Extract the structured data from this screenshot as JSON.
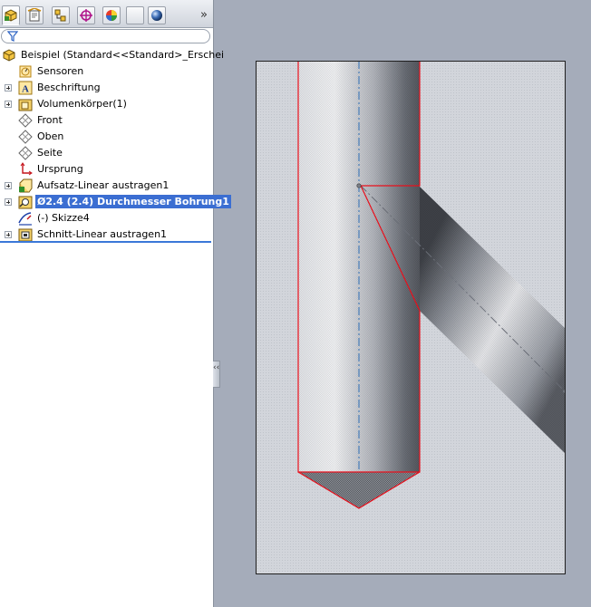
{
  "tabs": [
    {
      "name": "featuremanager-tab",
      "icon": "featuremanager-icon"
    },
    {
      "name": "propertymanager-tab",
      "icon": "propertymanager-icon"
    },
    {
      "name": "configurationmanager-tab",
      "icon": "configurationmanager-icon"
    },
    {
      "name": "dimxpert-tab",
      "icon": "dimxpert-icon"
    },
    {
      "name": "display-manager-tab",
      "icon": "display-manager-icon"
    },
    {
      "name": "empty-tab",
      "icon": ""
    },
    {
      "name": "appearance-tab",
      "icon": "sphere-icon"
    }
  ],
  "tabs_more": "»",
  "filter": {
    "icon": "filter-icon",
    "value": ""
  },
  "tree": {
    "root": {
      "label": "Beispiel  (Standard<<Standard>_Erschei",
      "icon": "part-icon"
    },
    "items": [
      {
        "label": "Sensoren",
        "icon": "sensor-icon",
        "expandable": false
      },
      {
        "label": "Beschriftung",
        "icon": "annotation-icon",
        "expandable": true
      },
      {
        "label": "Volumenkörper(1)",
        "icon": "solid-bodies-icon",
        "expandable": true
      },
      {
        "label": "Front",
        "icon": "plane-icon",
        "expandable": false
      },
      {
        "label": "Oben",
        "icon": "plane-icon",
        "expandable": false
      },
      {
        "label": "Seite",
        "icon": "plane-icon",
        "expandable": false
      },
      {
        "label": "Ursprung",
        "icon": "origin-icon",
        "expandable": false
      },
      {
        "label": "Aufsatz-Linear austragen1",
        "icon": "extrude-boss-icon",
        "expandable": true
      },
      {
        "label": "Ø2.4 (2.4) Durchmesser Bohrung1",
        "icon": "hole-icon",
        "expandable": true,
        "selected": true
      },
      {
        "label": "(-) Skizze4",
        "icon": "sketch-icon",
        "expandable": false
      },
      {
        "label": "Schnitt-Linear austragen1",
        "icon": "extrude-cut-icon",
        "expandable": true
      }
    ]
  },
  "collapse_handle": "‹‹",
  "colors": {
    "selection": "#3b6ed2",
    "highlight_edge": "#e8101c",
    "centerline": "#2f6fb6",
    "viewport_bg": "#a5acba"
  }
}
